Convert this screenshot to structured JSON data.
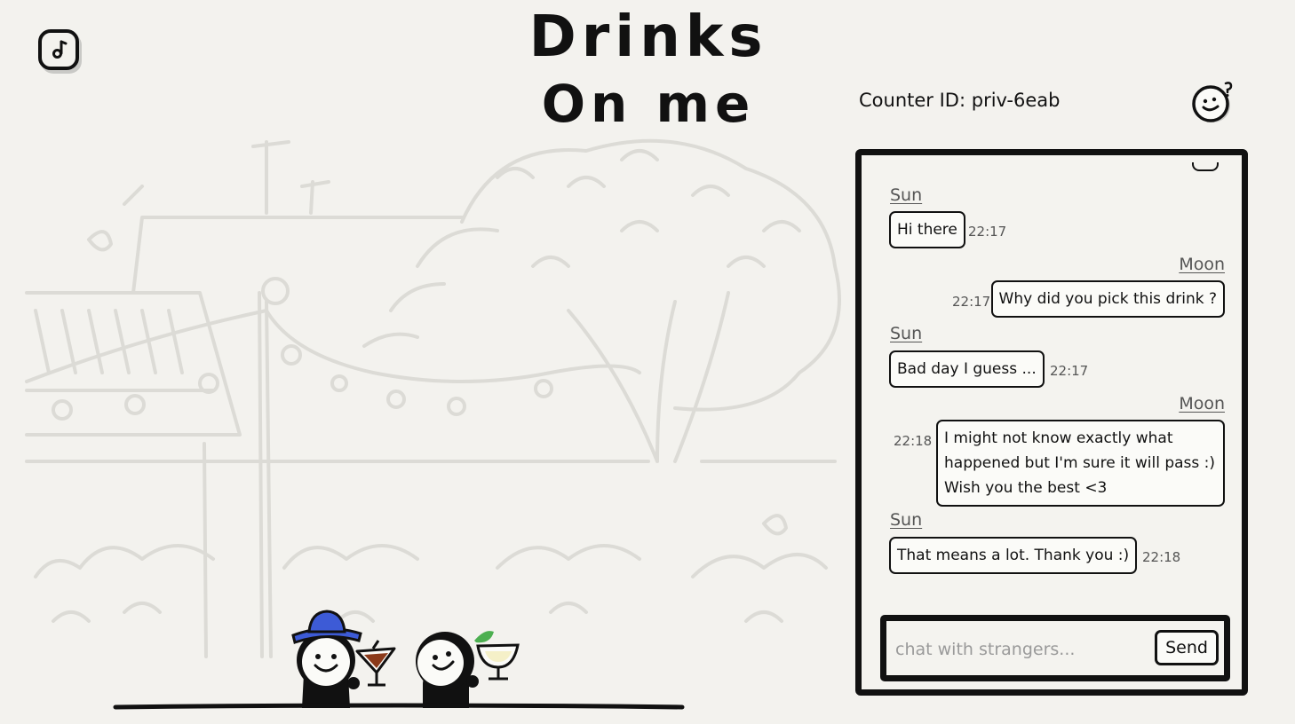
{
  "title": {
    "line1": "Drinks",
    "line2": "On me"
  },
  "counter": {
    "label": "Counter ID:",
    "id": "priv-6eab"
  },
  "icons": {
    "music": "music-note-icon",
    "help": "smiley-question-icon"
  },
  "chat": {
    "messages": [
      {
        "sender": "Sun",
        "text": "Hi there",
        "time": "22:17",
        "side": "left"
      },
      {
        "sender": "Moon",
        "text": "Why did you pick this drink ?",
        "time": "22:17",
        "side": "right"
      },
      {
        "sender": "Sun",
        "text": "Bad day I guess ...",
        "time": "22:17",
        "side": "left"
      },
      {
        "sender": "Moon",
        "lines": [
          "I might not know exactly what",
          "happened but I'm sure it will pass :)",
          "Wish you the best <3"
        ],
        "time": "22:18",
        "side": "right"
      },
      {
        "sender": "Sun",
        "text": "That means a lot. Thank you :)",
        "time": "22:18",
        "side": "left"
      }
    ],
    "input_placeholder": "chat with strangers...",
    "input_value": "",
    "send_label": "Send"
  },
  "colors": {
    "background": "#f3f2ee",
    "ink": "#111111",
    "sketch": "#dcdbd6",
    "hat": "#3d5bd6",
    "drink": "#8b3a1a",
    "garnish": "#4caf50"
  }
}
